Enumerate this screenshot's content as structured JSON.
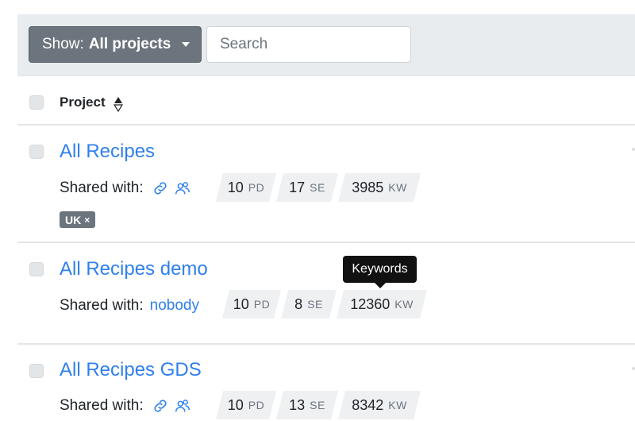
{
  "toolbar": {
    "show_prefix": "Show:",
    "show_value": "All projects",
    "search_placeholder": "Search",
    "search_value": ""
  },
  "table": {
    "header_label": "Project"
  },
  "projects": [
    {
      "title": "All Recipes",
      "shared_label": "Shared with:",
      "shared_value": "",
      "share_icons": [
        "link-icon",
        "users-icon"
      ],
      "stats": [
        {
          "num": "10",
          "unit": "PD"
        },
        {
          "num": "17",
          "unit": "SE"
        },
        {
          "num": "3985",
          "unit": "KW"
        }
      ],
      "tags": [
        {
          "label": "UK",
          "remove": "×"
        }
      ]
    },
    {
      "title": "All Recipes demo",
      "shared_label": "Shared with:",
      "shared_value": "nobody",
      "share_icons": [],
      "stats": [
        {
          "num": "10",
          "unit": "PD"
        },
        {
          "num": "8",
          "unit": "SE"
        },
        {
          "num": "12360",
          "unit": "KW"
        }
      ],
      "tags": []
    },
    {
      "title": "All Recipes GDS",
      "shared_label": "Shared with:",
      "shared_value": "",
      "share_icons": [
        "link-icon",
        "users-icon"
      ],
      "stats": [
        {
          "num": "10",
          "unit": "PD"
        },
        {
          "num": "13",
          "unit": "SE"
        },
        {
          "num": "8342",
          "unit": "KW"
        }
      ],
      "tags": []
    }
  ],
  "tooltip": {
    "text": "Keywords"
  },
  "colors": {
    "link": "#2f80ed",
    "button": "#6c757d",
    "toolbar_bg": "#e9ecef",
    "stat_bg": "#eef0f2",
    "tooltip_bg": "#111111"
  }
}
